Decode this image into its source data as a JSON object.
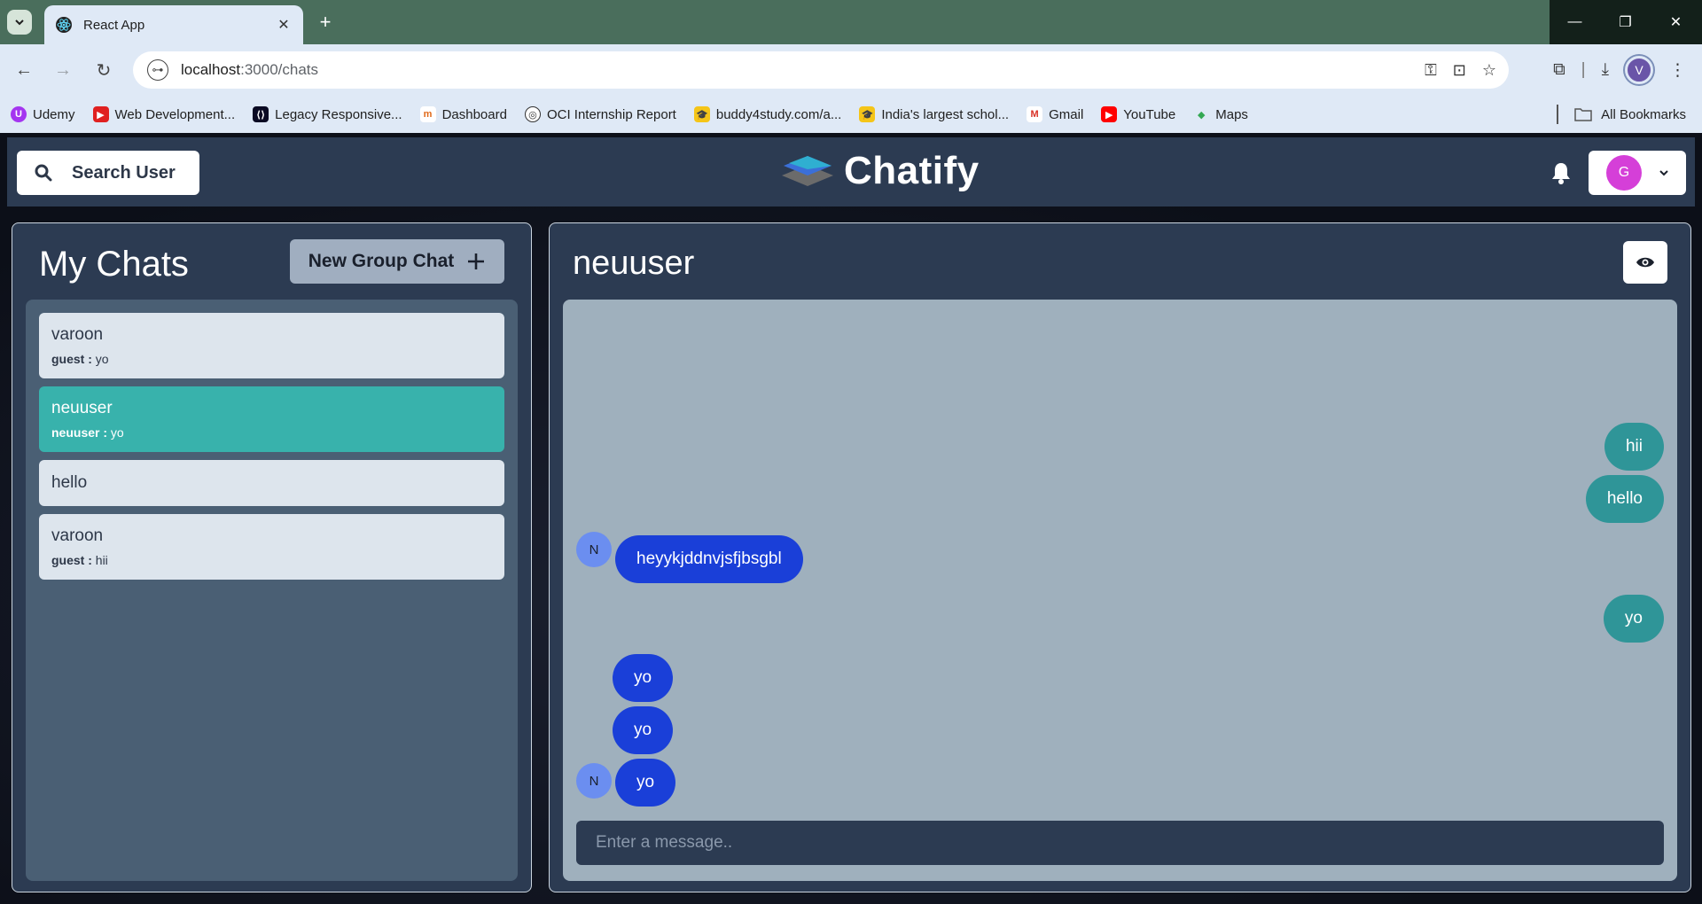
{
  "browser": {
    "tab_title": "React App",
    "url_host": "localhost",
    "url_path": ":3000/chats",
    "profile_initial": "V",
    "bookmarks": [
      {
        "label": "Udemy",
        "color": "#a435f0",
        "glyph": "U"
      },
      {
        "label": "Web Development...",
        "color": "#e02020",
        "glyph": "▶"
      },
      {
        "label": "Legacy Responsive...",
        "color": "#0a0a23",
        "glyph": "⟨⟩"
      },
      {
        "label": "Dashboard",
        "color": "#ffffff",
        "glyph": "m"
      },
      {
        "label": "OCI Internship Report",
        "color": "#ffffff",
        "glyph": "◎"
      },
      {
        "label": "buddy4study.com/a...",
        "color": "#f5c518",
        "glyph": "🎓"
      },
      {
        "label": "India's largest schol...",
        "color": "#f5c518",
        "glyph": "🎓"
      },
      {
        "label": "Gmail",
        "color": "#ffffff",
        "glyph": "M"
      },
      {
        "label": "YouTube",
        "color": "#ff0000",
        "glyph": "▶"
      },
      {
        "label": "Maps",
        "color": "#ffffff",
        "glyph": "📍"
      }
    ],
    "all_bookmarks": "All Bookmarks"
  },
  "appbar": {
    "search_label": "Search User",
    "logo_text": "Chatify",
    "profile_initial": "G"
  },
  "mychats": {
    "heading": "My Chats",
    "new_group_label": "New Group Chat",
    "chats": [
      {
        "name": "varoon",
        "sender": "guest : ",
        "latest": "yo",
        "active": false
      },
      {
        "name": "neuuser",
        "sender": "neuuser : ",
        "latest": "yo",
        "active": true
      },
      {
        "name": "hello",
        "sender": "",
        "latest": "",
        "active": false
      },
      {
        "name": "varoon",
        "sender": "guest : ",
        "latest": "hii",
        "active": false
      }
    ]
  },
  "chat": {
    "heading": "neuuser",
    "input_placeholder": "Enter a message..",
    "messages": [
      {
        "text": "hii",
        "mine": true
      },
      {
        "text": "hello",
        "mine": true
      },
      {
        "text": "heyykjddnvjsfjbsgbl",
        "mine": false,
        "avatar": "N"
      },
      {
        "text": "yo",
        "mine": true
      },
      {
        "text": "yo",
        "mine": false
      },
      {
        "text": "yo",
        "mine": false
      },
      {
        "text": "yo",
        "mine": false,
        "avatar": "N"
      }
    ]
  },
  "colors": {
    "active_chat": "#38b2ac",
    "my_bubble": "#2f9598",
    "their_bubble": "#1a3fd8"
  }
}
